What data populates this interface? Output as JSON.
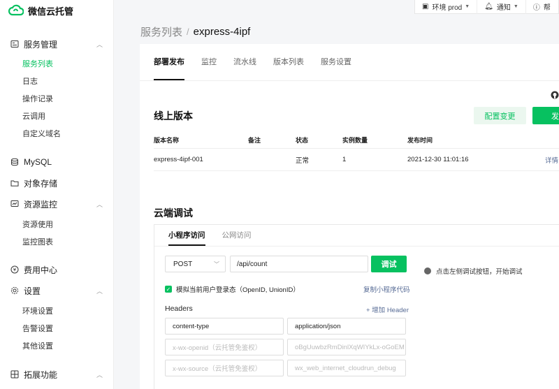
{
  "app": {
    "title": "微信云托管"
  },
  "topbar": {
    "env": "环境 prod",
    "notify": "通知",
    "help": "帮"
  },
  "sidebar": {
    "groups": [
      {
        "label": "服务管理",
        "icon": "service-icon",
        "items": [
          "服务列表",
          "日志",
          "操作记录",
          "云调用",
          "自定义域名"
        ]
      },
      {
        "label": "MySQL",
        "icon": "database-icon",
        "items": []
      },
      {
        "label": "对象存储",
        "icon": "folder-icon",
        "items": []
      },
      {
        "label": "资源监控",
        "icon": "monitor-icon",
        "items": [
          "资源使用",
          "监控图表"
        ]
      },
      {
        "label": "费用中心",
        "icon": "fee-icon",
        "items": []
      },
      {
        "label": "设置",
        "icon": "settings-icon",
        "items": [
          "环境设置",
          "告警设置",
          "其他设置"
        ]
      },
      {
        "label": "拓展功能",
        "icon": "extension-icon",
        "items": []
      }
    ],
    "active_item": "服务列表"
  },
  "breadcrumb": {
    "parent": "服务列表",
    "sep": "/",
    "current": "express-4ipf"
  },
  "tabs": [
    "部署发布",
    "监控",
    "流水线",
    "版本列表",
    "服务设置"
  ],
  "online": {
    "title": "线上版本",
    "config_change": "配置变更",
    "publish": "发布",
    "columns": [
      "版本名称",
      "备注",
      "状态",
      "实例数量",
      "发布时间"
    ],
    "rows": [
      {
        "name": "express-4ipf-001",
        "note": "",
        "status": "正常",
        "instances": "1",
        "time": "2021-12-30 11:01:16",
        "action": "详情"
      }
    ]
  },
  "cloud_debug": {
    "title": "云端调试",
    "tabs": [
      "小程序访问",
      "公网访问"
    ],
    "method": "POST",
    "path": "/api/count",
    "debug_button": "调试",
    "hint": "点击左侧调试按钮，开始调试",
    "simulate_login": "模拟当前用户登录态（OpenID, UnionID）",
    "copy_code": "复制小程序代码",
    "headers_label": "Headers",
    "add_header": "+ 增加 Header",
    "headers": [
      {
        "key": "content-type",
        "value": "application/json",
        "placeholder": false
      },
      {
        "key": "x-wx-openid（云托管免鉴权）",
        "value": "oBgUuwbzRmDinlXqWIYkLx-oGoEM",
        "placeholder": true
      },
      {
        "key": "x-wx-source（云托管免鉴权）",
        "value": "wx_web_internet_cloudrun_debug",
        "placeholder": true
      }
    ]
  }
}
